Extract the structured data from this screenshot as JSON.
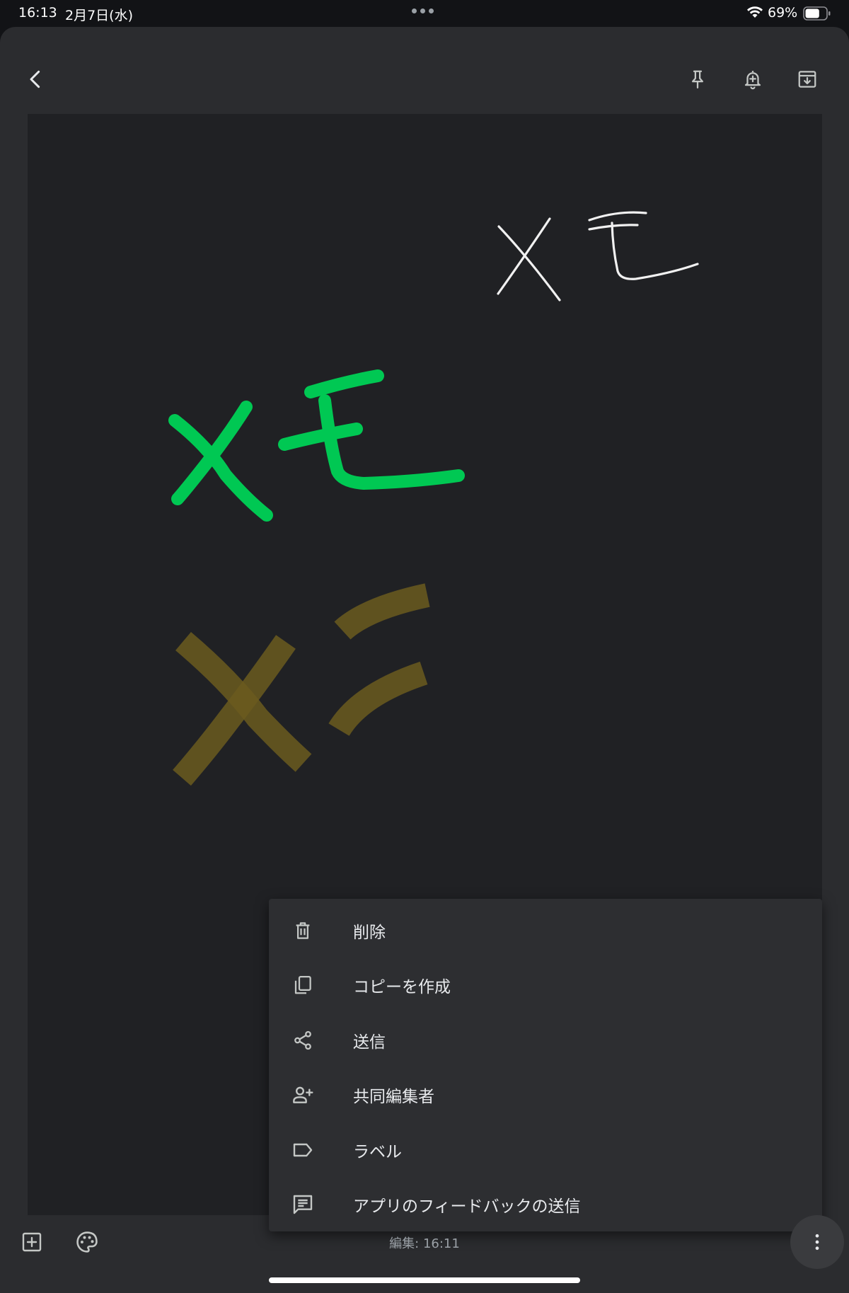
{
  "status_bar": {
    "time": "16:13",
    "date": "2月7日(水)",
    "battery_percent": "69%",
    "battery_level": 0.69
  },
  "toolbar": {
    "back_icon": "chevron-left-icon",
    "pin_icon": "pin-icon",
    "reminder_icon": "bell-plus-icon",
    "archive_icon": "archive-icon"
  },
  "drawing": {
    "strokes": [
      {
        "color": "#ffffff",
        "description": "handwritten-memo-white"
      },
      {
        "color": "#00c853",
        "description": "handwritten-memo-green"
      },
      {
        "color": "#6b5a1e",
        "description": "handwritten-memo-highlighter"
      }
    ]
  },
  "menu": {
    "items": [
      {
        "label": "削除",
        "icon": "trash-icon"
      },
      {
        "label": "コピーを作成",
        "icon": "copy-icon"
      },
      {
        "label": "送信",
        "icon": "share-icon"
      },
      {
        "label": "共同編集者",
        "icon": "person-add-icon"
      },
      {
        "label": "ラベル",
        "icon": "label-icon"
      },
      {
        "label": "アプリのフィードバックの送信",
        "icon": "feedback-icon"
      }
    ]
  },
  "bottom_bar": {
    "edited_text": "編集: 16:11",
    "add_icon": "add-box-icon",
    "palette_icon": "palette-icon",
    "more_icon": "more-vertical-icon"
  },
  "colors": {
    "background": "#2b2c2f",
    "canvas": "#202124",
    "menu": "#2d2e31",
    "text": "#e8eaed",
    "icon": "#c4c7c5",
    "green_ink": "#00c853",
    "highlighter_ink": "#6b5a1e"
  }
}
